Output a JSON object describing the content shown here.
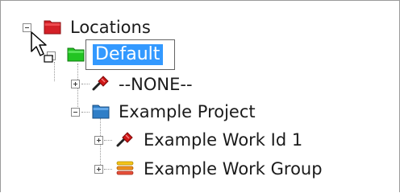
{
  "tree": {
    "root": {
      "label": "Locations",
      "icon": "red-folder-icon",
      "expanded": true
    },
    "nodes": [
      {
        "key": "default",
        "label": "Default",
        "icon": "green-folder-icon",
        "expanded": true,
        "editing": true
      },
      {
        "key": "none",
        "label": "--NONE--",
        "icon": "red-pin-icon",
        "expanded": false
      },
      {
        "key": "example-project",
        "label": "Example Project",
        "icon": "blue-folder-icon",
        "expanded": true
      },
      {
        "key": "example-work-id",
        "label": "Example Work Id 1",
        "icon": "red-pin-icon",
        "expanded": false
      },
      {
        "key": "example-work-group",
        "label": "Example Work Group",
        "icon": "stack-icon",
        "expanded": false
      }
    ],
    "edit_field": {
      "value": "Default"
    }
  },
  "colors": {
    "selection": "#3399ff",
    "red_folder": "#d42027",
    "green_folder": "#22c422",
    "blue_folder": "#2f7ec7",
    "pin_red": "#d01818"
  }
}
